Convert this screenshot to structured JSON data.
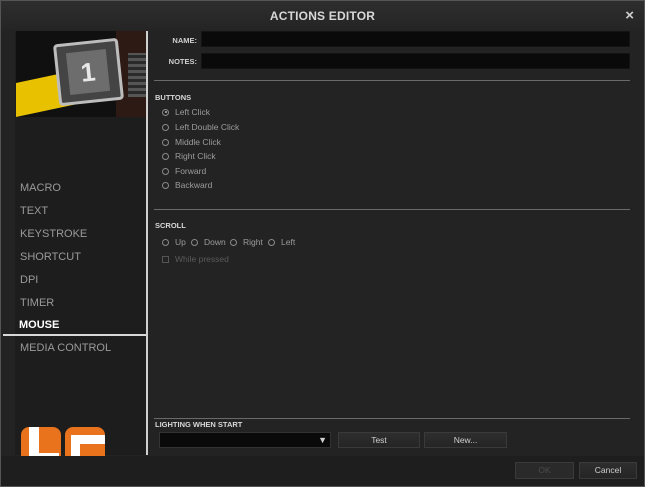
{
  "window": {
    "title": "ACTIONS EDITOR",
    "close_icon": "×"
  },
  "sidebar": {
    "preview_key_label": "1",
    "items": [
      {
        "label": "MACRO"
      },
      {
        "label": "TEXT"
      },
      {
        "label": "KEYSTROKE"
      },
      {
        "label": "SHORTCUT"
      },
      {
        "label": "DPI"
      },
      {
        "label": "TIMER"
      },
      {
        "label": "MOUSE",
        "active": true
      },
      {
        "label": "MEDIA CONTROL"
      }
    ]
  },
  "form": {
    "name_label": "NAME:",
    "name_value": "",
    "notes_label": "NOTES:",
    "notes_value": ""
  },
  "buttons_section": {
    "title": "BUTTONS",
    "options": [
      {
        "label": "Left Click",
        "checked": true
      },
      {
        "label": "Left Double Click",
        "checked": false
      },
      {
        "label": "Middle Click",
        "checked": false
      },
      {
        "label": "Right Click",
        "checked": false
      },
      {
        "label": "Forward",
        "checked": false
      },
      {
        "label": "Backward",
        "checked": false
      }
    ]
  },
  "scroll_section": {
    "title": "SCROLL",
    "options": [
      {
        "label": "Up"
      },
      {
        "label": "Down"
      },
      {
        "label": "Right"
      },
      {
        "label": "Left"
      }
    ],
    "while_pressed_label": "While pressed"
  },
  "lighting": {
    "title": "LIGHTING WHEN START",
    "selected_value": "",
    "dropdown_arrow": "▼",
    "test_label": "Test",
    "new_label": "New..."
  },
  "footer": {
    "ok_label": "OK",
    "cancel_label": "Cancel"
  },
  "colors": {
    "accent_orange": "#e8731c",
    "logo_white": "#ffffff",
    "yellow": "#e8c200"
  }
}
